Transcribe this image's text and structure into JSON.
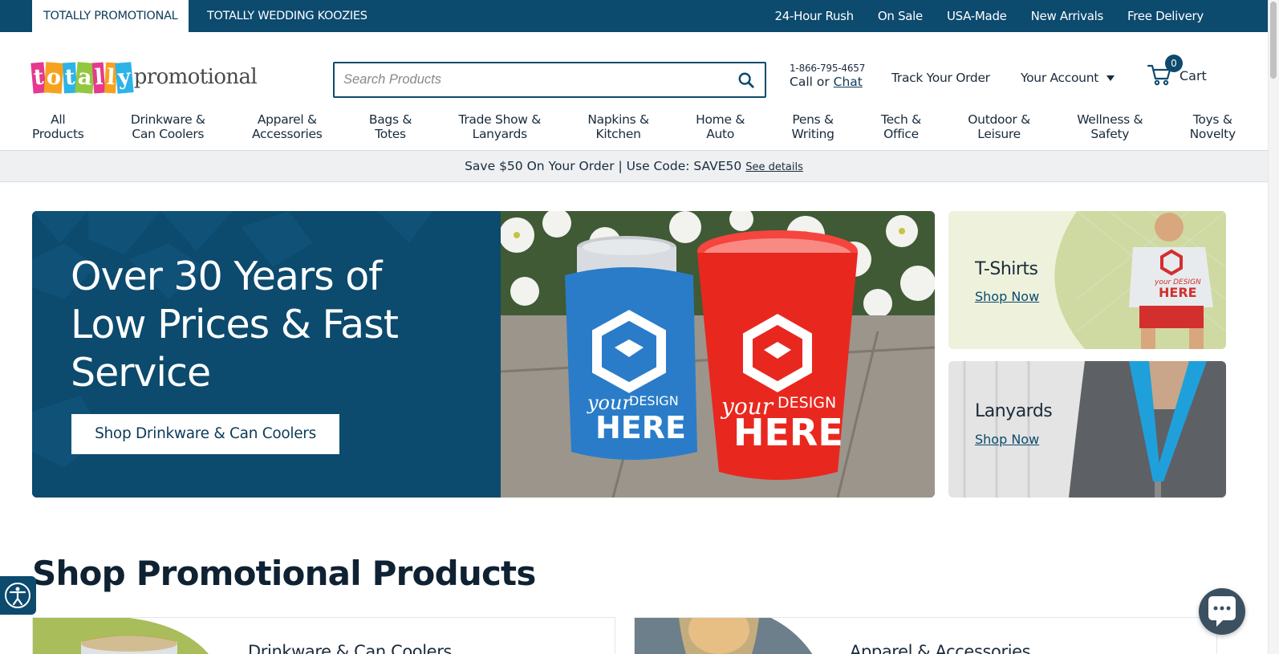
{
  "topbar": {
    "site_tabs": [
      {
        "label": "TOTALLY PROMOTIONAL",
        "active": true
      },
      {
        "label": "TOTALLY WEDDING KOOZIES",
        "active": false
      }
    ],
    "links": [
      "24-Hour Rush",
      "On Sale",
      "USA-Made",
      "New Arrivals",
      "Free Delivery"
    ]
  },
  "header": {
    "logo": {
      "letters": [
        "t",
        "o",
        "t",
        "a",
        "l",
        "l",
        "y"
      ],
      "rest": "promotional",
      "icon": "totally-promotional-logo"
    },
    "search": {
      "placeholder": "Search Products",
      "value": "",
      "icon": "search-icon"
    },
    "phone": {
      "number": "1-866-795-4657",
      "call_text": "Call or ",
      "chat_text": "Chat"
    },
    "track_order": "Track Your Order",
    "account": {
      "label": "Your Account",
      "icon": "caret-down-icon"
    },
    "cart": {
      "label": "Cart",
      "count": "0",
      "icon": "cart-icon"
    }
  },
  "categories": [
    {
      "line1": "All",
      "line2": "Products"
    },
    {
      "line1": "Drinkware &",
      "line2": "Can Coolers"
    },
    {
      "line1": "Apparel &",
      "line2": "Accessories"
    },
    {
      "line1": "Bags &",
      "line2": "Totes"
    },
    {
      "line1": "Trade Show &",
      "line2": "Lanyards"
    },
    {
      "line1": "Napkins &",
      "line2": "Kitchen"
    },
    {
      "line1": "Home &",
      "line2": "Auto"
    },
    {
      "line1": "Pens &",
      "line2": "Writing"
    },
    {
      "line1": "Tech &",
      "line2": "Office"
    },
    {
      "line1": "Outdoor &",
      "line2": "Leisure"
    },
    {
      "line1": "Wellness &",
      "line2": "Safety"
    },
    {
      "line1": "Toys &",
      "line2": "Novelty"
    }
  ],
  "promo": {
    "text": "Save $50 On Your Order | Use Code: SAVE50",
    "details_link": "See details"
  },
  "hero": {
    "heading_lines": [
      "Over 30 Years of",
      "Low Prices & Fast",
      "Service"
    ],
    "button_label": "Shop Drinkware & Can Coolers",
    "photo_texts": [
      "your",
      "DESIGN",
      "HERE"
    ]
  },
  "side_cards": [
    {
      "title": "T-Shirts",
      "link": "Shop Now"
    },
    {
      "title": "Lanyards",
      "link": "Shop Now"
    }
  ],
  "section": {
    "title": "Shop Promotional Products",
    "cards": [
      {
        "title": "Drinkware & Can Coolers"
      },
      {
        "title": "Apparel & Accessories"
      }
    ]
  },
  "colors": {
    "brand_navy": "#0c4a6e",
    "logo_letters": [
      "#e6398f",
      "#f6a21e",
      "#2db3e8",
      "#93c83e",
      "#e6398f",
      "#f6a21e",
      "#2db3e8"
    ],
    "koozie_blue": "#2a7cc8",
    "cup_red": "#e8281f"
  },
  "floating": {
    "accessibility_icon": "accessibility-icon",
    "chat_icon": "chat-bubble-icon"
  }
}
